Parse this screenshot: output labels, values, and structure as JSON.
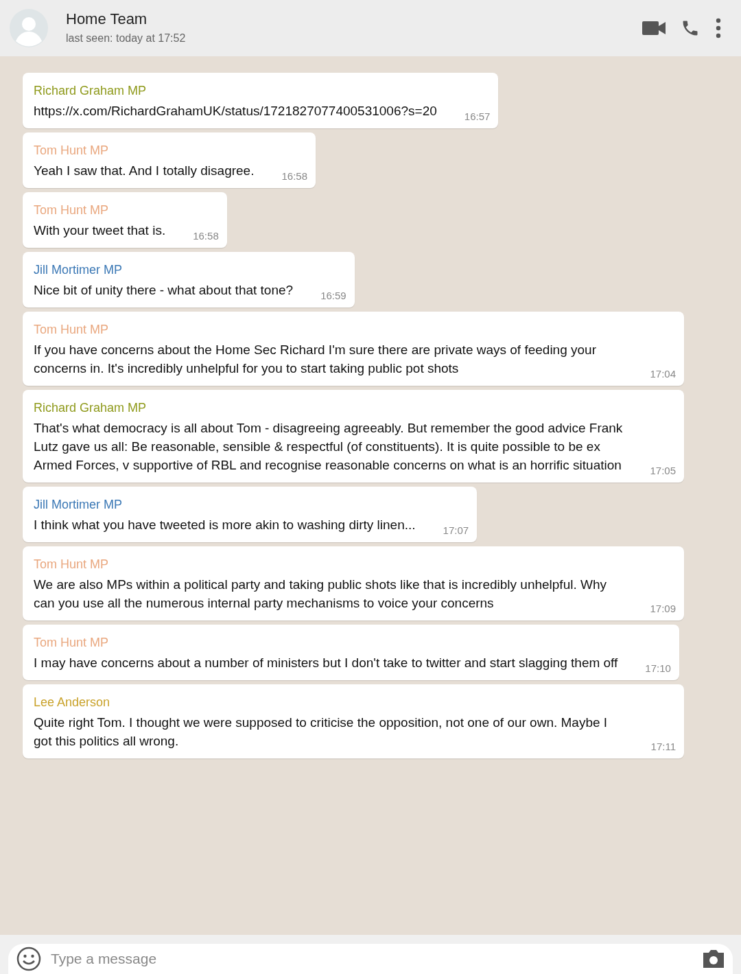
{
  "header": {
    "title": "Home Team",
    "subtitle": "last seen: today at 17:52"
  },
  "messages": [
    {
      "sender": "Richard Graham MP",
      "color": "#8f9a1c",
      "text": "https://x.com/RichardGrahamUK/status/1721827077400531006?s=20",
      "time": "16:57"
    },
    {
      "sender": "Tom Hunt MP",
      "color": "#e9a77e",
      "text": "Yeah I saw that. And I totally disagree.",
      "time": "16:58"
    },
    {
      "sender": "Tom Hunt MP",
      "color": "#e9a77e",
      "text": "With your tweet that is.",
      "time": "16:58"
    },
    {
      "sender": "Jill Mortimer MP",
      "color": "#3b78b5",
      "text": "Nice bit of unity there - what about that tone?",
      "time": "16:59"
    },
    {
      "sender": "Tom Hunt MP",
      "color": "#e9a77e",
      "text": "If you have concerns about the Home Sec Richard I'm sure there are private ways of feeding your concerns in. It's incredibly unhelpful for you to start taking public pot shots",
      "time": "17:04"
    },
    {
      "sender": "Richard Graham MP",
      "color": "#8f9a1c",
      "text": "That's what democracy is all about Tom - disagreeing agreeably. But remember the good advice Frank Lutz gave us all: Be reasonable, sensible & respectful (of constituents). It is quite possible to be ex Armed Forces, v supportive of RBL and recognise reasonable concerns on what is an horrific situation",
      "time": "17:05"
    },
    {
      "sender": "Jill Mortimer MP",
      "color": "#3b78b5",
      "text": "I think what you have tweeted is more akin to washing dirty linen...",
      "time": "17:07"
    },
    {
      "sender": "Tom Hunt MP",
      "color": "#e9a77e",
      "text": "We are also MPs within a political party and taking public shots like that is incredibly unhelpful. Why can you use all the numerous internal party mechanisms to voice your concerns",
      "time": "17:09"
    },
    {
      "sender": "Tom Hunt MP",
      "color": "#e9a77e",
      "text": "I may have concerns about a number of ministers but I don't take to twitter and start slagging them off",
      "time": "17:10"
    },
    {
      "sender": "Lee Anderson",
      "color": "#c9a22a",
      "text": "Quite right Tom. I thought we were supposed to criticise the opposition, not one of our own. Maybe I got this politics all wrong.",
      "time": "17:11"
    }
  ],
  "composer": {
    "placeholder": "Type a message"
  }
}
